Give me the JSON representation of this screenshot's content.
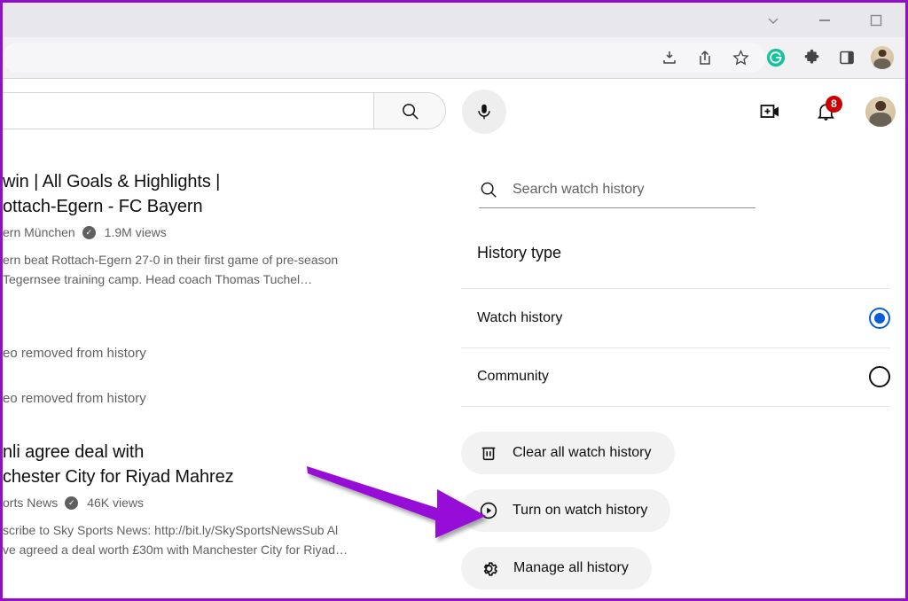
{
  "window": {
    "controls": [
      {
        "name": "chevron-down",
        "glyph": "chevron"
      },
      {
        "name": "minimize",
        "glyph": "minimize"
      },
      {
        "name": "maximize",
        "glyph": "maximize"
      }
    ]
  },
  "browser_toolbar": {
    "icons": [
      {
        "name": "download-icon"
      },
      {
        "name": "share-icon"
      },
      {
        "name": "bookmark-star-icon"
      },
      {
        "name": "grammarly-extension-icon",
        "letter": "G",
        "color": "#15c39a"
      },
      {
        "name": "extensions-puzzle-icon"
      },
      {
        "name": "side-panel-icon"
      },
      {
        "name": "browser-profile-avatar"
      }
    ]
  },
  "youtube_header": {
    "search_placeholder": "",
    "search_value": "",
    "icons": [
      {
        "name": "search-icon"
      },
      {
        "name": "voice-search-icon"
      },
      {
        "name": "create-video-icon"
      },
      {
        "name": "notifications-bell-icon"
      },
      {
        "name": "account-avatar"
      }
    ],
    "notification_count": "8"
  },
  "history_list": {
    "videos": [
      {
        "title_line1": "win | All Goals & Highlights |",
        "title_line2": "ottach-Egern - FC Bayern",
        "channel": "ern München",
        "views": "1.9M views",
        "desc_line1": "ern beat Rottach-Egern 27-0 in their first game of pre-season",
        "desc_line2": "Tegernsee training camp. Head coach Thomas Tuchel…"
      },
      {
        "title_line1": "nli agree deal with",
        "title_line2": "chester City for Riyad Mahrez",
        "channel": "orts News",
        "views": "46K views",
        "desc_line1": "scribe to Sky Sports News: http://bit.ly/SkySportsNewsSub Al",
        "desc_line2": "ve agreed a deal worth £30m with Manchester City for Riyad…"
      }
    ],
    "removed_rows": [
      "eo removed from history",
      "eo removed from history"
    ]
  },
  "side_panel": {
    "search": {
      "placeholder": "Search watch history",
      "value": ""
    },
    "section_title": "History type",
    "options": [
      {
        "label": "Watch history",
        "selected": true
      },
      {
        "label": "Community",
        "selected": false
      }
    ],
    "actions": [
      {
        "label": "Clear all watch history",
        "icon": "trash-icon"
      },
      {
        "label": "Turn on watch history",
        "icon": "play-circle-icon"
      },
      {
        "label": "Manage all history",
        "icon": "gear-icon"
      }
    ]
  },
  "annotation": {
    "arrow_color": "#9610d8",
    "points_to": "Turn on watch history"
  },
  "colors": {
    "accent_blue": "#065fd4",
    "badge_red": "#cc0000",
    "annotation_purple": "#9610d8",
    "frame_purple": "#8e10c8",
    "pill_gray": "#f2f2f2"
  }
}
